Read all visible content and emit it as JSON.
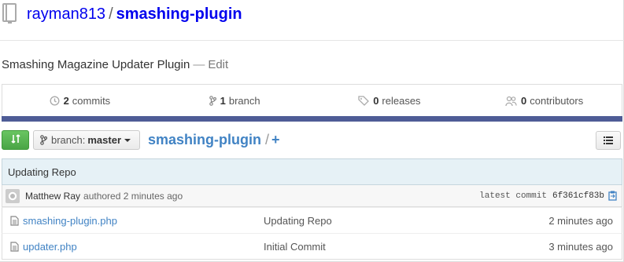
{
  "header": {
    "owner": "rayman813",
    "separator": "/",
    "repo": "smashing-plugin",
    "icon": "repo-book-icon"
  },
  "description": {
    "text": "Smashing Magazine Updater Plugin",
    "dash": "—",
    "edit_label": "Edit"
  },
  "stats": [
    {
      "count": "2",
      "label": "commits",
      "icon": "history-icon"
    },
    {
      "count": "1",
      "label": "branch",
      "icon": "branch-icon"
    },
    {
      "count": "0",
      "label": "releases",
      "icon": "tag-icon"
    },
    {
      "count": "0",
      "label": "contributors",
      "icon": "people-icon"
    }
  ],
  "colors": {
    "link": "#4183c4",
    "language_bar": "#4e5c96",
    "compare_green": "#55b550",
    "commit_bar_bg": "#e6f1f6"
  },
  "toolbar": {
    "branch_prefix": "branch:",
    "branch_name": "master",
    "crumb_root": "smashing-plugin",
    "crumb_slash": "/",
    "crumb_add": "+"
  },
  "latest_commit": {
    "message": "Updating Repo",
    "author": "Matthew Ray",
    "authored_text": "authored 2 minutes ago",
    "latest_label": "latest commit",
    "sha": "6f361cf83b"
  },
  "files": [
    {
      "name": "smashing-plugin.php",
      "message": "Updating Repo",
      "age": "2 minutes ago"
    },
    {
      "name": "updater.php",
      "message": "Initial Commit",
      "age": "3 minutes ago"
    }
  ]
}
